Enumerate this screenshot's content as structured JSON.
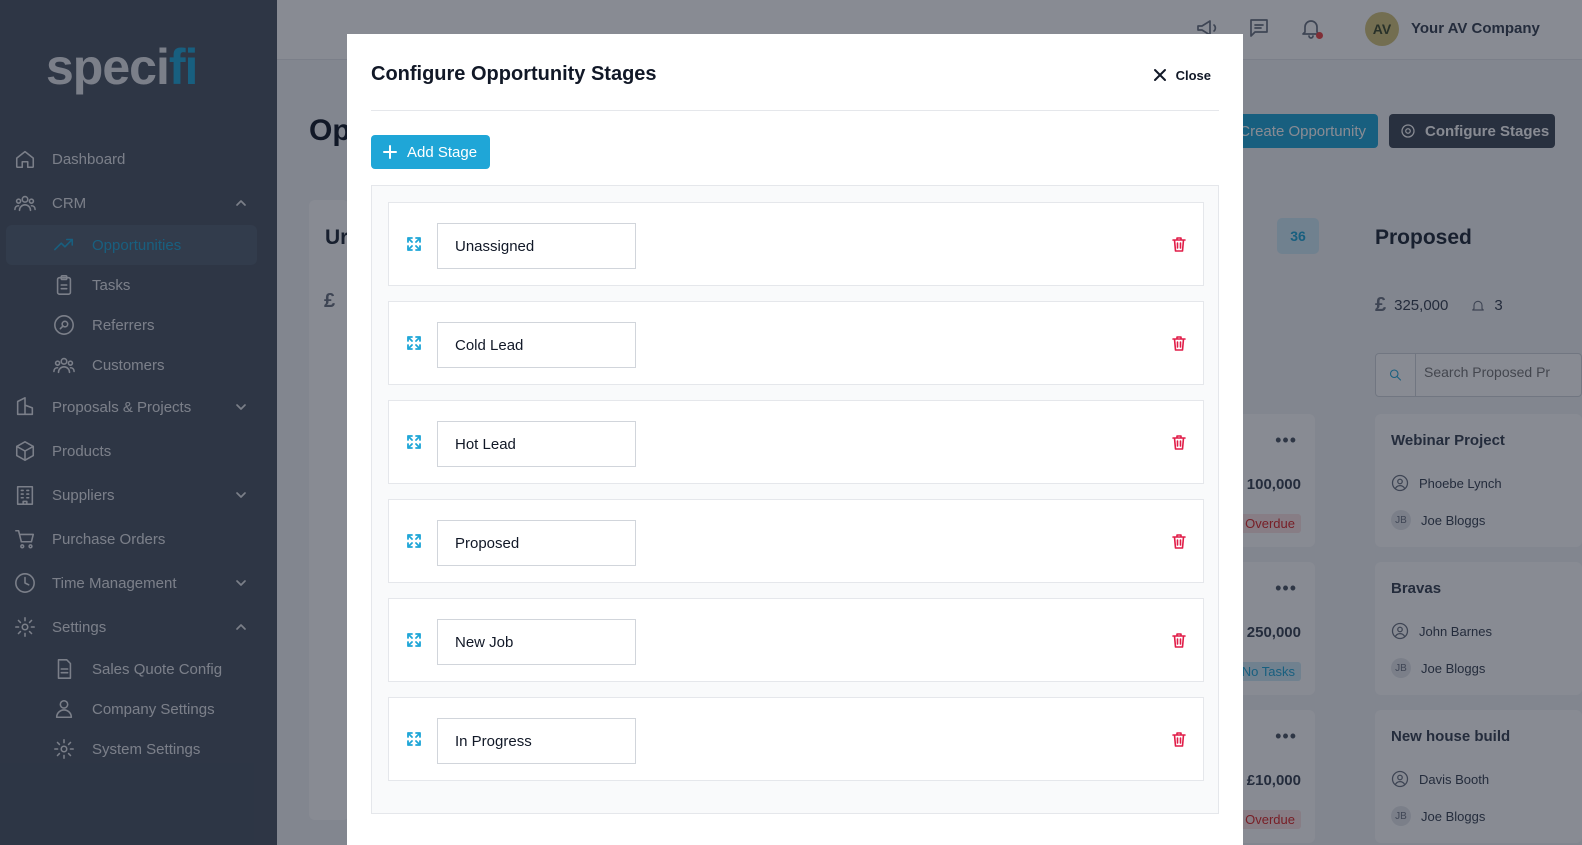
{
  "app": {
    "logo_main": "spec",
    "logo_i": "i",
    "logo_accent": "fi"
  },
  "sidebar": {
    "items": [
      {
        "label": "Dashboard",
        "icon": "home-icon"
      },
      {
        "label": "CRM",
        "icon": "users-icon",
        "expanded": true
      },
      {
        "label": "Opportunities",
        "icon": "trending-up-icon",
        "active": true
      },
      {
        "label": "Tasks",
        "icon": "clipboard-icon"
      },
      {
        "label": "Referrers",
        "icon": "search-circle-icon"
      },
      {
        "label": "Customers",
        "icon": "users-icon"
      },
      {
        "label": "Proposals & Projects",
        "icon": "document-icon",
        "expanded": false
      },
      {
        "label": "Products",
        "icon": "cube-icon"
      },
      {
        "label": "Suppliers",
        "icon": "building-icon",
        "expanded": false
      },
      {
        "label": "Purchase Orders",
        "icon": "cart-icon"
      },
      {
        "label": "Time Management",
        "icon": "clock-icon",
        "expanded": false
      },
      {
        "label": "Settings",
        "icon": "gear-icon",
        "expanded": true
      },
      {
        "label": "Sales Quote Config",
        "icon": "document-icon"
      },
      {
        "label": "Company Settings",
        "icon": "user-group-icon"
      },
      {
        "label": "System Settings",
        "icon": "gear-icon"
      }
    ]
  },
  "topbar": {
    "avatar_initials": "AV",
    "company_name": "Your AV Company"
  },
  "page": {
    "title_fragment": "Op",
    "create_button": "Create Opportunity",
    "configure_button": "Configure Stages"
  },
  "board": {
    "left_col_title_fragment": "Ur",
    "left_pound": "£",
    "middle_count": "36",
    "proposed": {
      "title": "Proposed",
      "currency": "£",
      "total": "325,000",
      "alerts": "3",
      "search_placeholder": "Search Proposed Pr"
    },
    "middle_cards": [
      {
        "amount": "100,000",
        "tag": "Overdue",
        "tag_style": "red"
      },
      {
        "amount": "250,000",
        "tag": "No Tasks",
        "tag_style": "blue"
      },
      {
        "amount": "£10,000",
        "tag": "Overdue",
        "tag_style": "red"
      }
    ],
    "proposed_cards": [
      {
        "title": "Webinar Project",
        "contact": "Phoebe Lynch",
        "owner_initials": "JB",
        "owner": "Joe Bloggs"
      },
      {
        "title": "Bravas",
        "contact": "John Barnes",
        "owner_initials": "JB",
        "owner": "Joe Bloggs"
      },
      {
        "title": "New house build",
        "contact": "Davis Booth",
        "owner_initials": "JB",
        "owner": "Joe Bloggs"
      }
    ]
  },
  "modal": {
    "title": "Configure Opportunity Stages",
    "close_label": "Close",
    "add_stage_label": "Add Stage",
    "stages": [
      "Unassigned",
      "Cold Lead",
      "Hot Lead",
      "Proposed",
      "New Job",
      "In Progress"
    ]
  },
  "colors": {
    "accent": "#1fa6d7",
    "sidebar_bg": "#4a5563",
    "danger": "#e11d48"
  }
}
